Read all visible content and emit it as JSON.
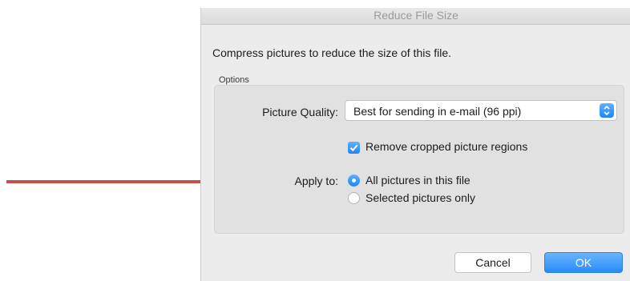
{
  "dialog": {
    "title": "Reduce File Size",
    "intro": "Compress pictures to reduce the size of this file.",
    "options_label": "Options",
    "picture_quality": {
      "label": "Picture Quality:",
      "value": "Best for sending in e-mail (96 ppi)"
    },
    "remove_cropped": {
      "label": "Remove cropped picture regions",
      "checked": true
    },
    "apply_to": {
      "label": "Apply to:",
      "options": [
        {
          "label": "All pictures in this file",
          "selected": true
        },
        {
          "label": "Selected pictures only",
          "selected": false
        }
      ]
    },
    "buttons": {
      "cancel": "Cancel",
      "ok": "OK"
    }
  },
  "colors": {
    "accent": "#2a8cf6",
    "arrow": "#c4524a",
    "dialog_bg": "#ececec",
    "group_bg": "#e1e1e1"
  },
  "icons": {
    "pointer": "arrow-right-icon",
    "stepper": "chevron-up-down-icon",
    "check": "checkmark-icon"
  }
}
